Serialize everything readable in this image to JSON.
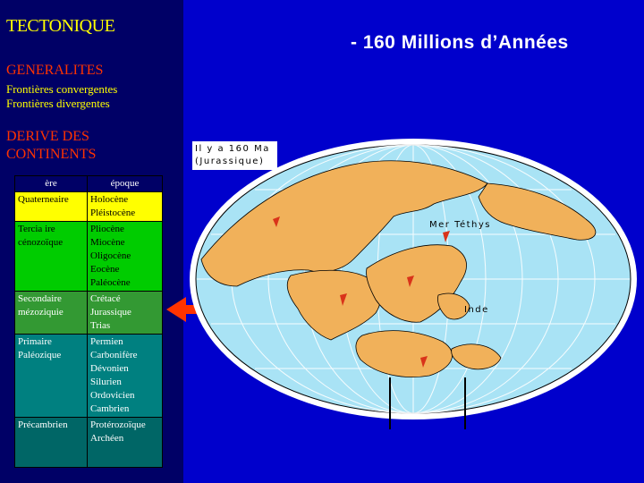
{
  "sidebar": {
    "title": "TECTONIQUE",
    "generalites": "GENERALITES",
    "links": [
      "Frontières convergentes",
      "Frontières divergentes"
    ],
    "derive_line1": "DERIVE DES",
    "derive_line2": "CONTINENTS"
  },
  "slide": {
    "title": "-  160 Millions d’Années"
  },
  "table": {
    "header_era": "ère",
    "header_epoch": "époque",
    "rows": [
      {
        "era": "Quaterneaire",
        "epochs": "Holocène\nPléistocène"
      },
      {
        "era": "Tercia ire\ncénozoïque",
        "epochs": "Pliocène\nMiocène\nOligocène\nEocène\nPaléocène"
      },
      {
        "era": "Secondaire\nmézoziquie",
        "epochs": "Crétacé\nJurassique\nTrias"
      },
      {
        "era": "Primaire\nPaléozique",
        "epochs": "Permien\nCarbonifère\nDévonien\nSilurien\nOrdovicien\nCambrien"
      },
      {
        "era": "Précambrien",
        "epochs": "Protérozoïque\nArchéen"
      }
    ]
  },
  "map": {
    "caption_line1": "Il y a 160 Ma",
    "caption_line2": "(Jurassique)",
    "label_tethys": "Mer Téthys",
    "label_inde": "Inde"
  },
  "colors": {
    "ocean": "#a9e3f5",
    "continent": "#f1b15a",
    "arrow": "#ff3300"
  }
}
